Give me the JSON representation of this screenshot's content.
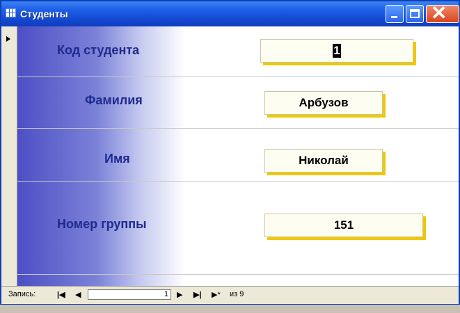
{
  "window": {
    "title": "Студенты"
  },
  "form": {
    "fields": [
      {
        "label": "Код студента",
        "value": "1"
      },
      {
        "label": "Фамилия",
        "value": "Арбузов"
      },
      {
        "label": "Имя",
        "value": "Николай"
      },
      {
        "label": "Номер группы",
        "value": "151"
      }
    ]
  },
  "navigation": {
    "record_label": "Запись:",
    "first_glyph": "|◀",
    "prev_glyph": "◀",
    "current_record": "1",
    "next_glyph": "▶",
    "last_glyph": "▶|",
    "new_glyph": "▶*",
    "total_text": "из 9"
  },
  "colors": {
    "titlebar": "#1d5ee6",
    "field_shadow": "#f0c800",
    "label_text": "#1e2a8e"
  }
}
